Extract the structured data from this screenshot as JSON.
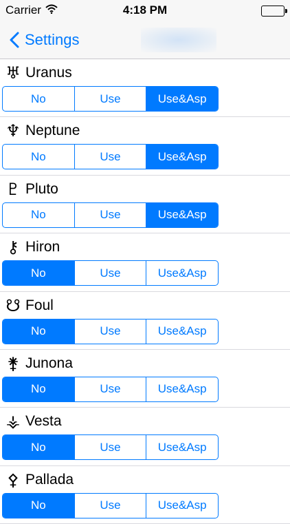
{
  "status_bar": {
    "carrier": "Carrier",
    "time": "4:18 PM"
  },
  "nav": {
    "back_label": "Settings"
  },
  "options": [
    "No",
    "Use",
    "Use&Asp"
  ],
  "accent_color": "#007aff",
  "bodies": [
    {
      "name": "Uranus",
      "glyph": "♅",
      "selected": "Use&Asp"
    },
    {
      "name": "Neptune",
      "glyph": "♆",
      "selected": "Use&Asp"
    },
    {
      "name": "Pluto",
      "glyph": "♇",
      "selected": "Use&Asp"
    },
    {
      "name": "Hiron",
      "glyph": "⚷",
      "selected": "No"
    },
    {
      "name": "Foul",
      "glyph": "☋",
      "selected": "No"
    },
    {
      "name": "Junona",
      "glyph": "⚵",
      "selected": "No"
    },
    {
      "name": "Vesta",
      "glyph": "⚶",
      "selected": "No"
    },
    {
      "name": "Pallada",
      "glyph": "⚴",
      "selected": "No"
    }
  ]
}
